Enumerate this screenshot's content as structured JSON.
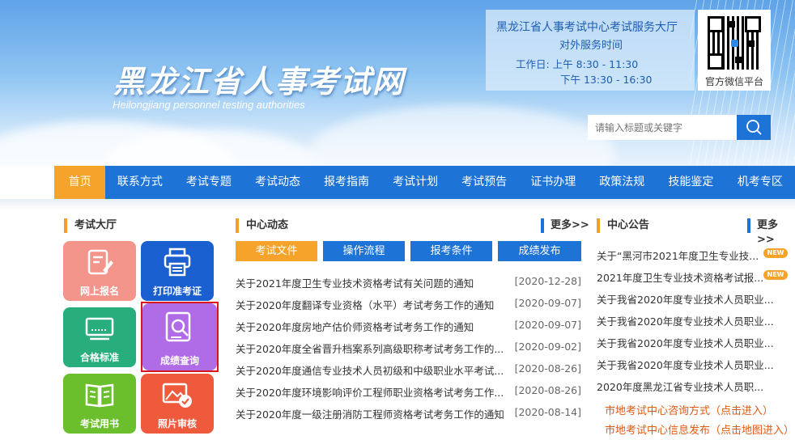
{
  "site": {
    "title": "黑龙江省人事考试网",
    "subtitle": "Heilongjiang personnel testing authorities"
  },
  "service": {
    "line1": "黑龙江省人事考试中心考试服务大厅",
    "line2": "对外服务时间",
    "line3": "工作日:  上午    8:30 - 11:30",
    "line4": "下午  13:30 - 16:30"
  },
  "qr": {
    "label": "官方微信平台"
  },
  "search": {
    "placeholder": "请输入标题或关键字",
    "icon": "search-icon"
  },
  "nav": [
    {
      "label": "首页",
      "active": true
    },
    {
      "label": "联系方式"
    },
    {
      "label": "考试专题"
    },
    {
      "label": "考试动态"
    },
    {
      "label": "报考指南"
    },
    {
      "label": "考试计划"
    },
    {
      "label": "考试预告"
    },
    {
      "label": "证书办理"
    },
    {
      "label": "政策法规"
    },
    {
      "label": "技能鉴定"
    },
    {
      "label": "机考专区"
    }
  ],
  "hall": {
    "title": "考试大厅",
    "tiles": [
      {
        "label": "网上报名",
        "color": "#f4958b",
        "icon": "form-edit-icon"
      },
      {
        "label": "打印准考证",
        "color": "#1a5fcf",
        "icon": "printer-icon"
      },
      {
        "label": "合格标准",
        "color": "#27ae7c",
        "icon": "monitor-icon"
      },
      {
        "label": "成绩查询",
        "color": "#b06be6",
        "icon": "search-document-icon"
      },
      {
        "label": "考试用书",
        "color": "#6bbf2c",
        "icon": "book-icon"
      },
      {
        "label": "照片审核",
        "color": "#ef5a3c",
        "icon": "photo-check-icon"
      }
    ]
  },
  "center_news": {
    "title": "中心动态",
    "more": "更多>>",
    "tabs": [
      {
        "label": "考试文件",
        "active": true
      },
      {
        "label": "操作流程"
      },
      {
        "label": "报考条件"
      },
      {
        "label": "成绩发布"
      }
    ],
    "items": [
      {
        "title": "关于2021年度卫生专业技术资格考试有关问题的通知",
        "date": "[2020-12-28]"
      },
      {
        "title": "关于2020年度翻译专业资格（水平）考试考务工作的通知",
        "date": "[2020-09-07]"
      },
      {
        "title": "关于2020年度房地产估价师资格考试考务工作的通知",
        "date": "[2020-09-07]"
      },
      {
        "title": "关于2020年度全省晋升档案系列高级职称考试考务工作的...",
        "date": "[2020-09-02]"
      },
      {
        "title": "关于2020年度通信专业技术人员初级和中级职业水平考试...",
        "date": "[2020-08-26]"
      },
      {
        "title": "关于2020年度环境影响评价工程师职业资格考试考务工作...",
        "date": "[2020-08-26]"
      },
      {
        "title": "关于2020年度一级注册消防工程师资格考试考务工作的通知",
        "date": "[2020-08-14]"
      }
    ]
  },
  "notice": {
    "title": "中心公告",
    "more": "更多>>",
    "new_badge": "NEW",
    "items": [
      {
        "title": "关于“黑河市2021年度卫生专业技...",
        "is_new": true
      },
      {
        "title": "2021年度卫生专业技术资格考试报...",
        "is_new": true
      },
      {
        "title": "关于我省2020年度专业技术人员职业..."
      },
      {
        "title": "关于我省2020年度专业技术人员职业..."
      },
      {
        "title": "关于我省2020年度专业技术人员职业..."
      },
      {
        "title": "关于我省2020年度专业技术人员职业..."
      },
      {
        "title": "2020年度黑龙江省专业技术人员职..."
      }
    ],
    "links": [
      "市地考试中心咨询方式（点击进入）",
      "市地考试中心信息发布（点击地图进入）"
    ]
  }
}
